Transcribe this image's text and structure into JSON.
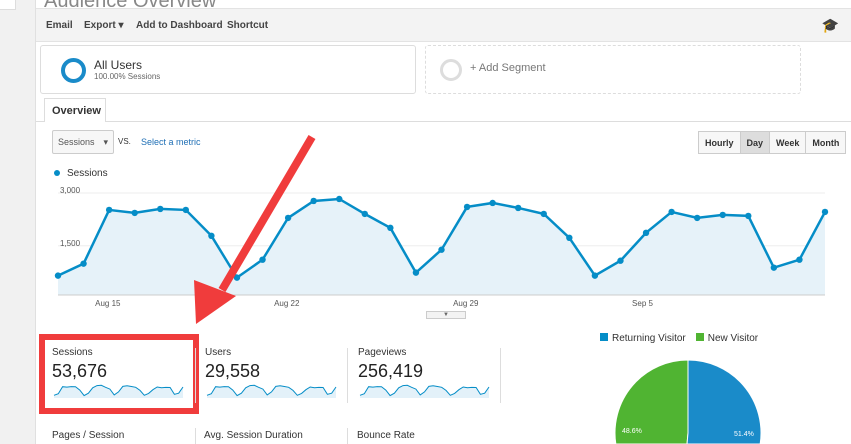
{
  "header": {
    "title": "Audience Overview"
  },
  "toolbar": {
    "email": "Email",
    "export": "Export ▾",
    "add_dashboard": "Add to Dashboard",
    "shortcut": "Shortcut",
    "cap_icon": "graduation-cap-icon"
  },
  "segments": {
    "all_users": "All Users",
    "all_users_sub": "100.00% Sessions",
    "add_segment": "+ Add Segment"
  },
  "tabs": {
    "overview": "Overview"
  },
  "controls": {
    "metric": "Sessions",
    "vs": "VS.",
    "select_metric": "Select a metric",
    "periods": [
      "Hourly",
      "Day",
      "Week",
      "Month"
    ],
    "active_period": "Day"
  },
  "chart_data": {
    "type": "area",
    "legend": "Sessions",
    "color": "#058dc7",
    "ylim": [
      100,
      3000
    ],
    "yticks": [
      "3,000",
      "1,500"
    ],
    "xticks": [
      "Aug 15",
      "Aug 22",
      "Aug 29",
      "Sep 5"
    ],
    "values": [
      651,
      991,
      2519,
      2434,
      2547,
      2519,
      1783,
      594,
      1104,
      2292,
      2774,
      2830,
      2406,
      2009,
      736,
      1387,
      2604,
      2717,
      2575,
      2406,
      1726,
      651,
      1075,
      1868,
      2462,
      2292,
      2377,
      2349,
      877,
      1104,
      2462
    ]
  },
  "metrics": [
    {
      "label": "Sessions",
      "value": "53,676"
    },
    {
      "label": "Users",
      "value": "29,558"
    },
    {
      "label": "Pageviews",
      "value": "256,419"
    }
  ],
  "metrics2": [
    {
      "label": "Pages / Session"
    },
    {
      "label": "Avg. Session Duration"
    },
    {
      "label": "Bounce Rate"
    }
  ],
  "pie": {
    "legend": [
      {
        "label": "Returning Visitor",
        "color": "#058dc7"
      },
      {
        "label": "New Visitor",
        "color": "#50b432"
      }
    ],
    "returning_pct": "51.4%",
    "new_pct": "48.6%",
    "returning": 51.4
  }
}
